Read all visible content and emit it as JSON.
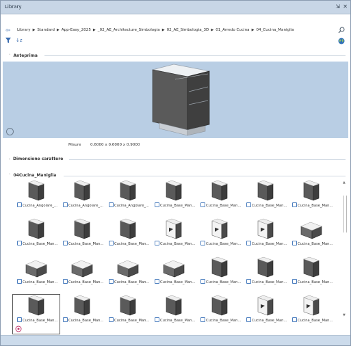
{
  "window": {
    "title": "Library",
    "pin_glyph": "⇲",
    "close_glyph": "✕"
  },
  "breadcrumb": {
    "back_icon": "back-arrow-icon",
    "segments": [
      "Library",
      "Standard",
      "App-Easy_2025",
      "_02_AE_Architecture_Simbologia",
      "02_AE_Simbologia_3D",
      "01_Arredo Cucina",
      "04_Cucina_Maniglia"
    ]
  },
  "toolbar": {
    "filter_icon": "funnel-icon",
    "sort_label": "↓z",
    "globe_icon": "globe-icon"
  },
  "sections": {
    "preview": {
      "label": "Anteprima",
      "chevron": "˅"
    },
    "font": {
      "label": "Dimensione carattere",
      "chevron": "›"
    },
    "folder": {
      "label": "04Cucina_Maniglia",
      "chevron": "˅"
    }
  },
  "preview": {
    "measure_label": "Misure",
    "measure_value": "0.6000 x 0.6000 x 0.9000"
  },
  "items": [
    "Cucina_Angolare_...",
    "Cucina_Angolare_...",
    "Cucina_Angolare_...",
    "Cucina_Base_Man...",
    "Cucina_Base_Man...",
    "Cucina_Base_Man...",
    "Cucina_Base_Man...",
    "Cucina_Base_Man...",
    "Cucina_Base_Man...",
    "Cucina_Base_Man...",
    "Cucina_Base_Man...",
    "Cucina_Base_Man...",
    "Cucina_Base_Man...",
    "Cucina_Base_Man...",
    "Cucina_Base_Man...",
    "Cucina_Base_Man...",
    "Cucina_Base_Man...",
    "Cucina_Base_Man...",
    "Cucina_Base_Man...",
    "Cucina_Base_Man...",
    "Cucina_Base_Man...",
    "Cucina_Base_Man...",
    "Cucina_Base_Man...",
    "Cucina_Base_Man...",
    "Cucina_Base_Man...",
    "Cucina_Base_Man...",
    "Cucina_Base_Man...",
    "Cucina_Base_Man..."
  ],
  "selected_index": 21,
  "colors": {
    "preview_bg": "#b9cee4",
    "titlebar_bg": "#c8d6e6",
    "accent": "#4e79b5",
    "cabinet_dark": "#4a4a4a"
  }
}
